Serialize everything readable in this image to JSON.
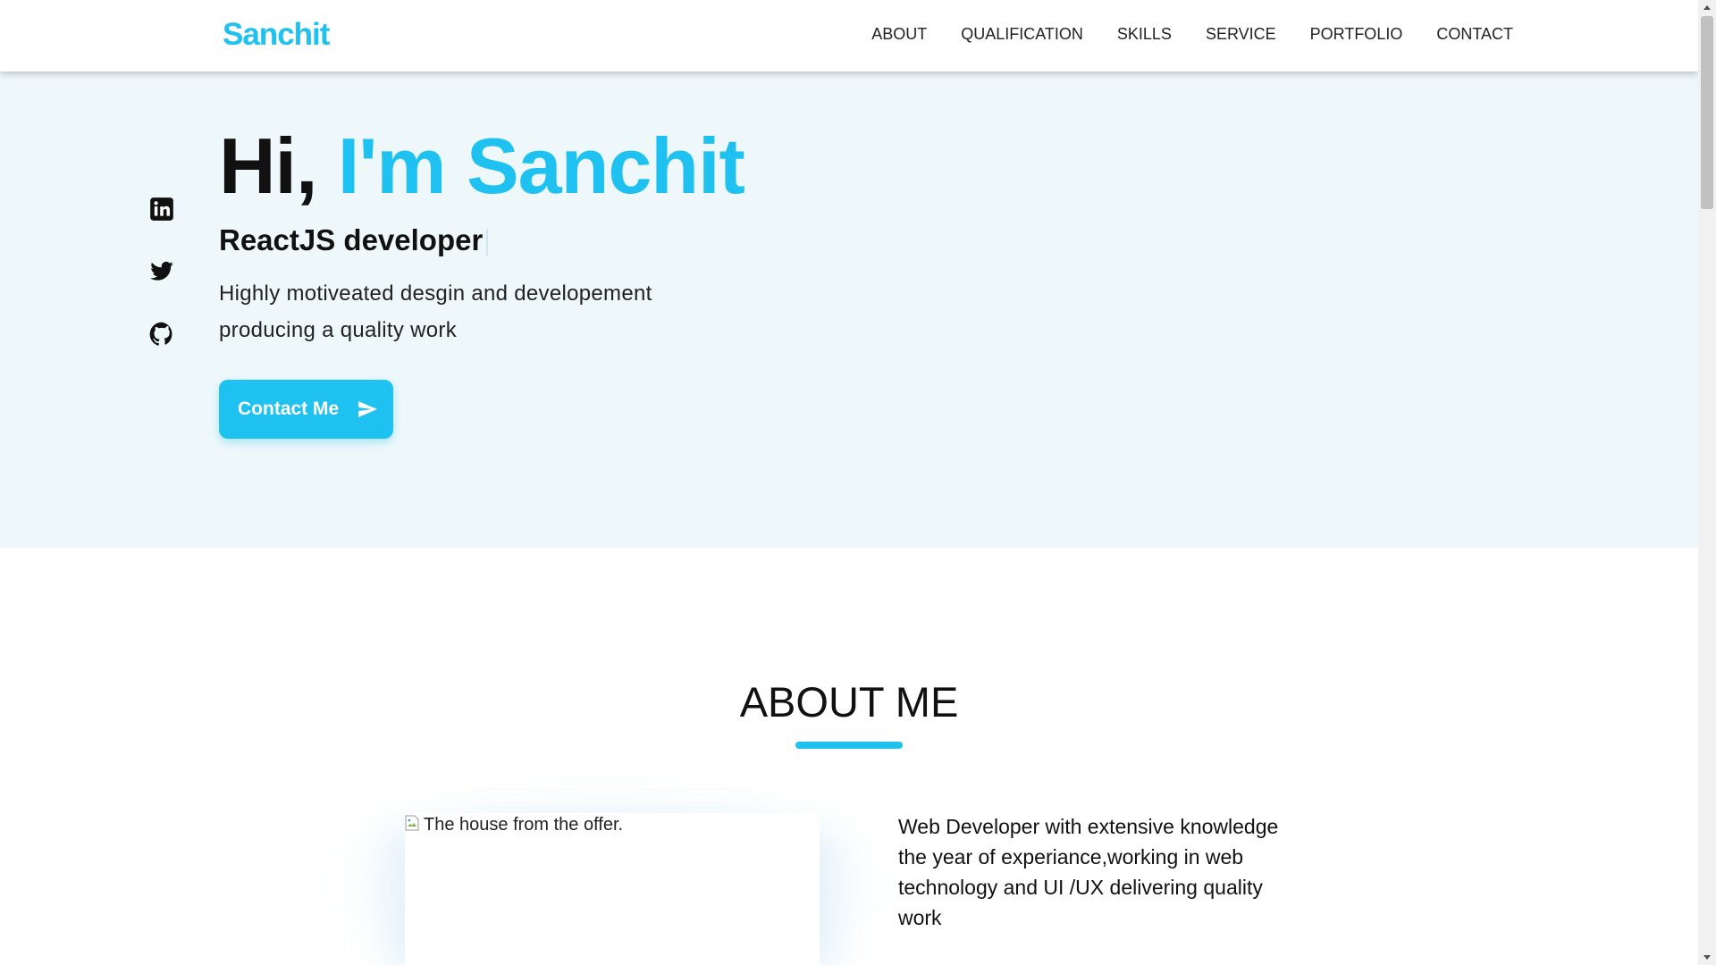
{
  "header": {
    "logo": "Sanchit",
    "nav": [
      "ABOUT",
      "QUALIFICATION",
      "SKILLS",
      "SERVICE",
      "PORTFOLIO",
      "CONTACT"
    ]
  },
  "hero": {
    "greeting": "Hi,",
    "name": "I'm Sanchit",
    "subtitle": "ReactJS developer",
    "description": "Highly motiveated desgin and developement producing a quality work",
    "button_label": "Contact Me",
    "social_icons": [
      "linkedin-icon",
      "twitter-icon",
      "github-icon"
    ]
  },
  "about": {
    "heading": "ABOUT ME",
    "image_alt": "The house from the offer.",
    "text": "Web Developer with extensive knowledge the year of experiance,working in web technology and UI /UX delivering quality work"
  },
  "colors": {
    "accent": "#1fc1f1",
    "hero_bg": "#eef8fb",
    "text": "#111111"
  }
}
